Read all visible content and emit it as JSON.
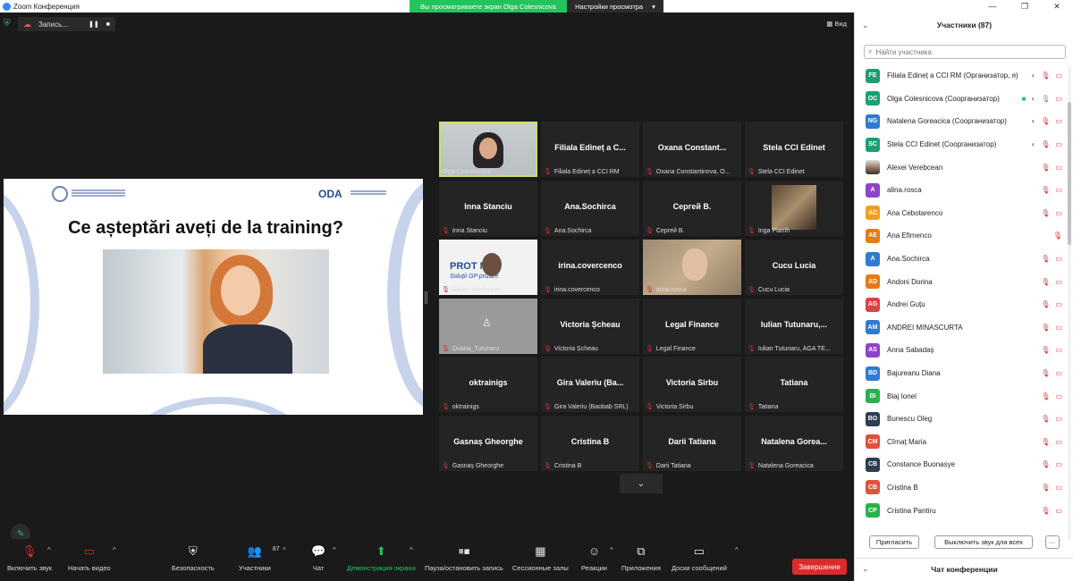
{
  "titlebar": {
    "app_title": "Zoom Конференция",
    "share_banner": "Вы просматриваете экран Olga Colesnicova",
    "view_settings": "Настройки просмотра",
    "minimize": "—",
    "maximize": "❐",
    "close": "✕"
  },
  "recording": {
    "label": "Запись...",
    "pause_icon": "❚❚",
    "stop_icon": "■"
  },
  "view_button": "Вид",
  "slide": {
    "question": "Ce așteptări aveți de la training?",
    "logo": "ODA"
  },
  "tiles": [
    {
      "title": "",
      "tag": "Olga Colesnicova",
      "muted": false
    },
    {
      "title": "Filiala Edineț a C...",
      "tag": "Filiala Edineț a CCI RM",
      "muted": true
    },
    {
      "title": "Oxana  Constant...",
      "tag": "Oxana Constantinova, O...",
      "muted": true
    },
    {
      "title": "Stela CCI Edinet",
      "tag": "Stela CCI Edinet",
      "muted": true
    },
    {
      "title": "Inna Stanciu",
      "tag": "Inna Stanciu",
      "muted": true
    },
    {
      "title": "Ana.Sochirca",
      "tag": "Ana.Sochirca",
      "muted": true
    },
    {
      "title": "Сергей В.",
      "tag": "Сергей В.",
      "muted": true
    },
    {
      "title": "",
      "tag": "Inga Pianîh",
      "muted": true
    },
    {
      "title": "",
      "tag": "Alexei Verebcean",
      "muted": true,
      "logo_top": "PROT    MD",
      "logo_bottom": "Soluții GP    prizare"
    },
    {
      "title": "irina.covercenco",
      "tag": "irina.covercenco",
      "muted": true
    },
    {
      "title": "",
      "tag": "alina.rosca",
      "muted": true
    },
    {
      "title": "Cucu Lucia",
      "tag": "Cucu Lucia",
      "muted": true
    },
    {
      "title": "",
      "tag": "Oxana_Tutunaru",
      "muted": true
    },
    {
      "title": "Victoria Șcheau",
      "tag": "Victoria Șcheau",
      "muted": true
    },
    {
      "title": "Legal Finance",
      "tag": "Legal Finance",
      "muted": true
    },
    {
      "title": "Iulian  Tutunaru,...",
      "tag": "Iulian Tutunaru, AGA TE...",
      "muted": true
    },
    {
      "title": "oktrainigs",
      "tag": "oktrainigs",
      "muted": true
    },
    {
      "title": "Gira Valeriu  (Ba...",
      "tag": "Gira Valeriu (Baobab SRL)",
      "muted": true
    },
    {
      "title": "Victoria Sirbu",
      "tag": "Victoria Sirbu",
      "muted": true
    },
    {
      "title": "Tatiana",
      "tag": "Tatiana",
      "muted": true
    },
    {
      "title": "Gasnaș Gheorghe",
      "tag": "Gasnaș Gheorghe",
      "muted": true
    },
    {
      "title": "Cristina B",
      "tag": "Cristina B",
      "muted": true
    },
    {
      "title": "Darii Tatiana",
      "tag": "Darii Tatiana",
      "muted": true
    },
    {
      "title": "Natalena  Gorea...",
      "tag": "Natalena Goreacica",
      "muted": true
    }
  ],
  "toolbar": {
    "unmute": "Включить звук",
    "start_video": "Начать видео",
    "security": "Безопасность",
    "participants": "Участники",
    "participants_count": "87",
    "chat": "Чат",
    "share_screen": "Демонстрация экрана",
    "pause_recording": "Пауза/остановить запись",
    "breakout_rooms": "Сессионные залы",
    "reactions": "Реакции",
    "apps": "Приложения",
    "whiteboards": "Доски сообщений",
    "end": "Завершение"
  },
  "panel": {
    "title": "Участники (87)",
    "search_placeholder": "Найти участника",
    "invite": "Пригласить",
    "mute_all": "Выключить звук для всех",
    "more": "···",
    "chat_title": "Чат конференции"
  },
  "participants": [
    {
      "initials": "FE",
      "color": "#1e9e75",
      "name": "Filiala Edineț a CCI RM (Организатор, я)",
      "icons": [
        "share-grey",
        "mic-off",
        "cam-off"
      ]
    },
    {
      "initials": "OC",
      "color": "#1e9e75",
      "name": "Olga Colesnicova (Соорганизатор)",
      "icons": [
        "share-green",
        "share-grey",
        "mic-on",
        "cam-off"
      ]
    },
    {
      "initials": "NG",
      "color": "#2f7bd1",
      "name": "Natalena Goreacica (Соорганизатор)",
      "icons": [
        "share-grey",
        "mic-off",
        "cam-off"
      ]
    },
    {
      "initials": "SC",
      "color": "#1e9e75",
      "name": "Stela CCI Edinet (Соорганизатор)",
      "icons": [
        "share-grey",
        "mic-off",
        "cam-off"
      ]
    },
    {
      "initials": "",
      "color": "",
      "name": "Alexei Verebcean",
      "icons": [
        "mic-off",
        "cam-on"
      ]
    },
    {
      "initials": "A",
      "color": "#8e44c9",
      "name": "alina.rosca",
      "icons": [
        "mic-off",
        "cam-on"
      ]
    },
    {
      "initials": "AC",
      "color": "#f0a020",
      "name": "Ana Cebotarenco",
      "icons": [
        "mic-off",
        "cam-off"
      ]
    },
    {
      "initials": "AE",
      "color": "#e67a18",
      "name": "Ana Efimenco",
      "icons": [
        "mic-off"
      ]
    },
    {
      "initials": "A",
      "color": "#2f7bd1",
      "name": "Ana.Sochirca",
      "icons": [
        "mic-off",
        "cam-off"
      ]
    },
    {
      "initials": "AD",
      "color": "#e67a18",
      "name": "Andoni Dorina",
      "icons": [
        "mic-off",
        "cam-off"
      ]
    },
    {
      "initials": "AG",
      "color": "#d94545",
      "name": "Andrei Guțu",
      "icons": [
        "mic-off",
        "cam-off"
      ]
    },
    {
      "initials": "AM",
      "color": "#2f7bd1",
      "name": "ANDREI MINASCURTA",
      "icons": [
        "mic-off",
        "cam-off"
      ]
    },
    {
      "initials": "AS",
      "color": "#8e44c9",
      "name": "Anna Sabadaș",
      "icons": [
        "mic-off",
        "cam-off"
      ]
    },
    {
      "initials": "BD",
      "color": "#2f7bd1",
      "name": "Bajureanu Diana",
      "icons": [
        "mic-off",
        "cam-off"
      ]
    },
    {
      "initials": "BI",
      "color": "#27b34a",
      "name": "Blaj Ionel",
      "icons": [
        "mic-off",
        "cam-off"
      ]
    },
    {
      "initials": "BO",
      "color": "#2c3e50",
      "name": "Bunescu Oleg",
      "icons": [
        "mic-off",
        "cam-off"
      ]
    },
    {
      "initials": "CM",
      "color": "#e0503a",
      "name": "Cîrnaț Maria",
      "icons": [
        "mic-off",
        "cam-off"
      ]
    },
    {
      "initials": "CB",
      "color": "#2c3e50",
      "name": "Constance Buonasye",
      "icons": [
        "mic-off",
        "cam-off"
      ]
    },
    {
      "initials": "CB",
      "color": "#e0503a",
      "name": "Cristina B",
      "icons": [
        "mic-off",
        "cam-off"
      ]
    },
    {
      "initials": "CP",
      "color": "#27b34a",
      "name": "Cristina Pantiru",
      "icons": [
        "mic-off",
        "cam-off"
      ]
    }
  ]
}
